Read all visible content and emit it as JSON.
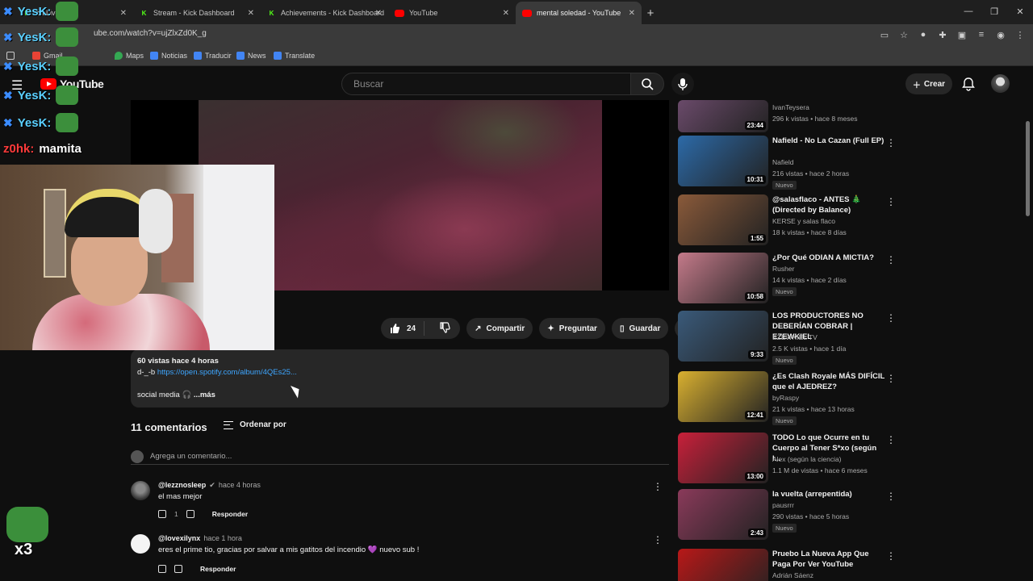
{
  "browser": {
    "tabs": [
      {
        "title": "rageylo Streaming Live on Kick",
        "visible_title": "ch Live on",
        "favicon": "kick",
        "active": false
      },
      {
        "title": "Stream - Kick Dashboard",
        "favicon": "kick",
        "active": false
      },
      {
        "title": "Achievements - Kick Dashboard",
        "favicon": "kick",
        "active": false
      },
      {
        "title": "YouTube",
        "favicon": "youtube",
        "active": false
      },
      {
        "title": "mental soledad - YouTube",
        "favicon": "youtube",
        "active": true
      }
    ],
    "new_tab_label": "+",
    "url": "ube.com/watch?v=ujZlxZd0K_g",
    "bookmarks": [
      {
        "label": "Gmail",
        "icon": "gmail-icon"
      },
      {
        "label": "Maps",
        "icon": "maps-icon"
      },
      {
        "label": "Noticias",
        "icon": "news-icon"
      },
      {
        "label": "Traducir",
        "icon": "translate-icon"
      },
      {
        "label": "News",
        "icon": "news-icon"
      },
      {
        "label": "Translate",
        "icon": "translate-icon"
      }
    ]
  },
  "youtube": {
    "search_placeholder": "Buscar",
    "create_label": "Crear",
    "like_count": "24",
    "actions": {
      "share": "Compartir",
      "ask": "Preguntar",
      "save": "Guardar"
    },
    "description": {
      "meta": "60 vistas  hace 4 horas",
      "line1_prefix": "d-_-b",
      "link": "https://open.spotify.com/album/4QEs25...",
      "line2": "social media 🎧",
      "more": "...más"
    },
    "comments": {
      "title": "11 comentarios",
      "sort_label": "Ordenar por",
      "add_placeholder": "Agrega un comentario...",
      "items": [
        {
          "author": "@lezznosleep",
          "time": "hace 4 horas",
          "text": "el mas mejor",
          "likes": "1",
          "reply": "Responder",
          "verified": true
        },
        {
          "author": "@lovexilynx",
          "time": "hace 1 hora",
          "text": "eres el prime tio, gracias por salvar a mis gatitos del incendio 💜 nuevo sub !",
          "likes": "",
          "reply": "Responder",
          "verified": false
        }
      ]
    },
    "recommendations": [
      {
        "title": "",
        "channel": "IvanTeysera",
        "stats": "296 k vistas • hace 8 meses",
        "duration": "23:44",
        "badge": "",
        "thumb_color": "#6a4a6a"
      },
      {
        "title": "Nafield - No La Cazan  (Full EP)",
        "channel": "Nafield",
        "stats": "216 vistas • hace 2 horas",
        "duration": "10:31",
        "badge": "Nuevo",
        "thumb_color": "#2c6aa8"
      },
      {
        "title": "@salasflaco  - ANTES 🎄 (Directed by Balance)",
        "channel": "KERSE y salas flaco",
        "stats": "18 k vistas • hace 8 días",
        "duration": "1:55",
        "badge": "",
        "thumb_color": "#8a5a3a"
      },
      {
        "title": "¿Por Qué ODIAN A MICTIA?",
        "channel": "Rusher",
        "stats": "14 k vistas • hace 2 días",
        "duration": "10:58",
        "badge": "Nuevo",
        "thumb_color": "#c47a8a"
      },
      {
        "title": "LOS PRODUCTORES NO DEBERÍAN COBRAR | EZEWKIEL",
        "channel": "EZEWKIEL TV",
        "stats": "2.5 K vistas • hace 1 día",
        "duration": "9:33",
        "badge": "Nuevo",
        "thumb_color": "#3a5a7a"
      },
      {
        "title": "¿Es Clash Royale MÁS DIFÍCIL que el AJEDREZ?",
        "channel": "byRaspy",
        "stats": "21 k vistas • hace 13 horas",
        "duration": "12:41",
        "badge": "Nuevo",
        "thumb_color": "#d9b030"
      },
      {
        "title": "TODO Lo que Ocurre en tu Cuerpo al Tener S*xo (según l...",
        "channel": "Alex (según la ciencia)",
        "stats": "1.1 M de vistas • hace 6 meses",
        "duration": "13:00",
        "badge": "",
        "thumb_color": "#c8203a"
      },
      {
        "title": "la vuelta (arrepentida)",
        "channel": "pausrrr",
        "stats": "290 vistas • hace 5 horas",
        "duration": "2:43",
        "badge": "Nuevo",
        "thumb_color": "#8a3a5a"
      },
      {
        "title": "Pruebo La Nueva App Que Paga Por Ver YouTube",
        "channel": "Adrián Sáenz",
        "stats": "",
        "duration": "",
        "badge": "",
        "thumb_color": "#b81818"
      }
    ]
  },
  "overlay": {
    "chat": [
      {
        "user": "YesK:",
        "msg": ""
      },
      {
        "user": "YesK:",
        "msg": ""
      },
      {
        "user": "YesK:",
        "msg": ""
      },
      {
        "user": "YesK:",
        "msg": ""
      },
      {
        "user": "YesK:",
        "msg": ""
      },
      {
        "user": "z0hk:",
        "msg": "mamita"
      }
    ],
    "multiplier": "x3"
  },
  "colors": {
    "yt_red": "#ff0000",
    "link_blue": "#3ea6ff",
    "bg": "#0f0f0f",
    "kick_green": "#53fc18"
  }
}
